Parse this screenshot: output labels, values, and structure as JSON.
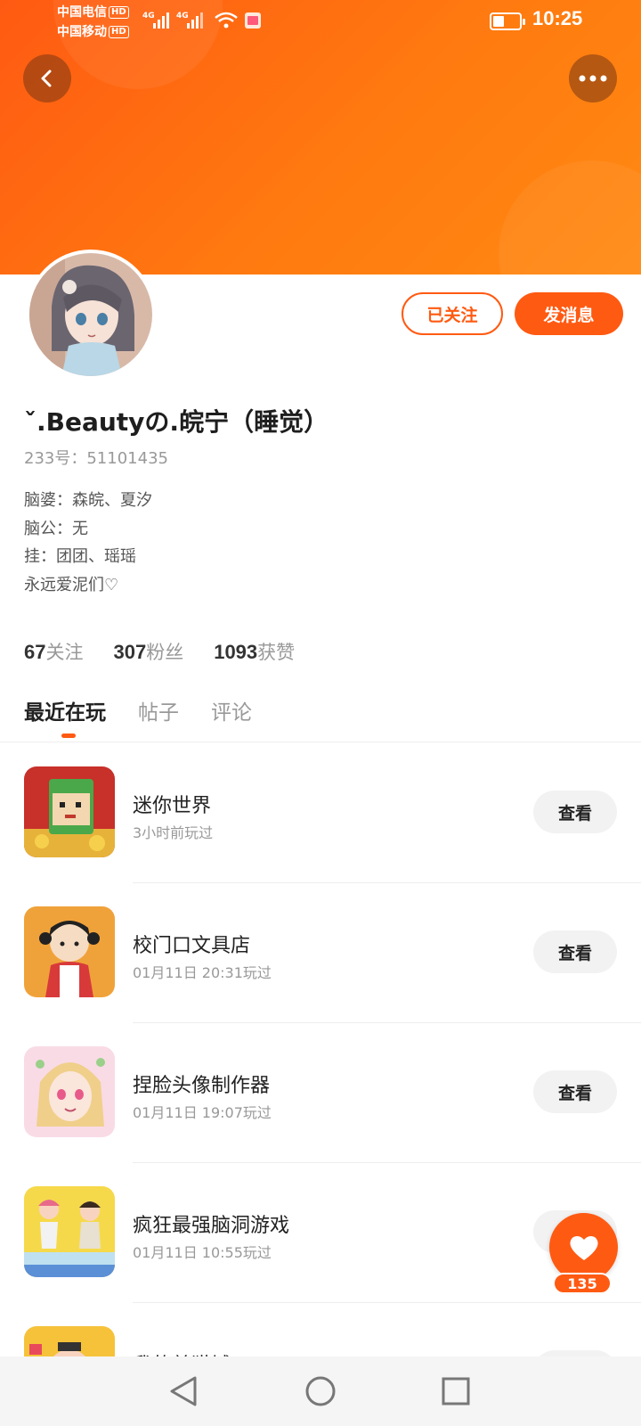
{
  "status_bar": {
    "carrier1": "中国电信",
    "carrier2": "中国移动",
    "hd": "HD",
    "network": "4G",
    "time": "10:25"
  },
  "profile": {
    "username": "ˇ.Beautyの.皖宁（睡觉）",
    "id_text": "233号：51101435",
    "bio": [
      "脑婆：森皖、夏汐",
      "脑公：无",
      "挂：团团、瑶瑶",
      "永远爱泥们♡"
    ],
    "follow_label": "已关注",
    "message_label": "发消息"
  },
  "stats": [
    {
      "num": "67",
      "label": "关注"
    },
    {
      "num": "307",
      "label": "粉丝"
    },
    {
      "num": "1093",
      "label": "获赞"
    }
  ],
  "tabs": [
    "最近在玩",
    "帖子",
    "评论"
  ],
  "games": [
    {
      "name": "迷你世界",
      "time": "3小时前玩过",
      "button": "查看"
    },
    {
      "name": "校门口文具店",
      "time": "01月11日 20:31玩过",
      "button": "查看"
    },
    {
      "name": "捏脸头像制作器",
      "time": "01月11日 19:07玩过",
      "button": "查看"
    },
    {
      "name": "疯狂最强脑洞游戏",
      "time": "01月11日 10:55玩过",
      "button": "查看"
    },
    {
      "name": "我的美猫城",
      "time": "",
      "button": "查看"
    }
  ],
  "like": {
    "count": "135"
  },
  "colors": {
    "accent": "#ff5a12",
    "banner": "#ff7a10"
  }
}
